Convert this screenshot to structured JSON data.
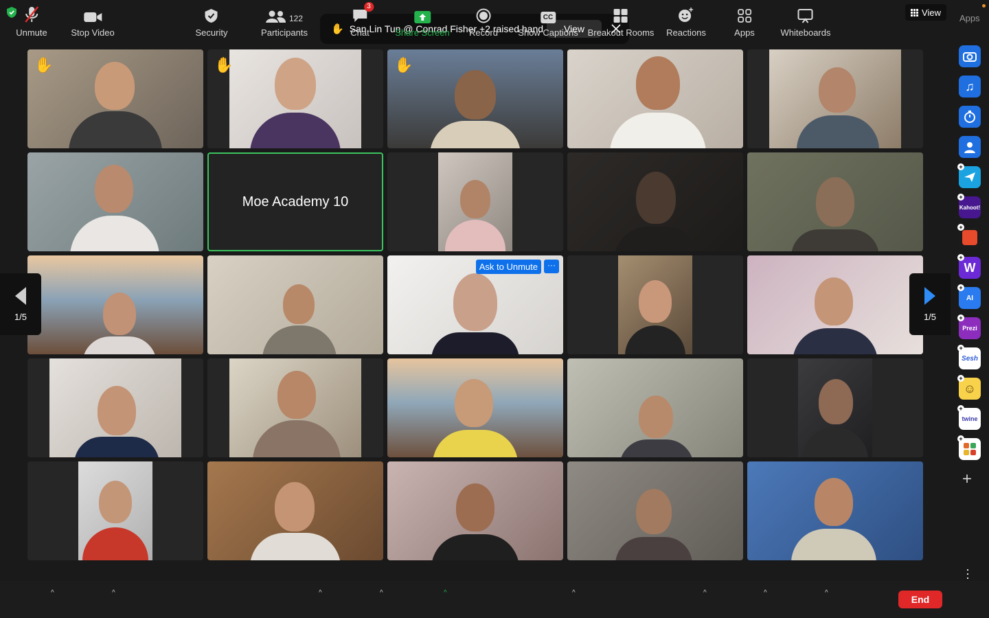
{
  "banner": {
    "hand": "✋",
    "text": "San Lin Tun @ Conrad Fisher +2 raised hand",
    "view_label": "View"
  },
  "top_right": {
    "view_label": "View",
    "apps_label": "Apps"
  },
  "named_tile": {
    "name": "Moe Academy 10"
  },
  "ask_to_unmute": {
    "label": "Ask to Unmute",
    "more": "···"
  },
  "raised_hand_glyph": "✋",
  "pager": {
    "left_label": "1/5",
    "right_label": "1/5"
  },
  "apps_sidebar": [
    {
      "name": "camera-app-icon",
      "label": "",
      "color": "#1f6fe0"
    },
    {
      "name": "music-app-icon",
      "label": "",
      "color": "#1f6fe0"
    },
    {
      "name": "timer-app-icon",
      "label": "",
      "color": "#1f6fe0"
    },
    {
      "name": "avatar-app-icon",
      "label": "",
      "color": "#1f6fe0"
    },
    {
      "name": "send-app-icon",
      "label": "",
      "color": "#1aa3e0"
    },
    {
      "name": "kahoot-app-icon",
      "label": "Kahoot!",
      "color": "#46178f"
    },
    {
      "name": "red-app-icon",
      "label": "",
      "color": "#e84a2c"
    },
    {
      "name": "w-app-icon",
      "label": "W",
      "color": "#6b2ad6"
    },
    {
      "name": "ai-app-icon",
      "label": "AI",
      "color": "#2a7bf0"
    },
    {
      "name": "prezi-app-icon",
      "label": "Prezi",
      "color": "#8c2dbe"
    },
    {
      "name": "sesh-app-icon",
      "label": "Sesh",
      "color": "#ffffff"
    },
    {
      "name": "emoji-app-icon",
      "label": "",
      "color": "#f8d24a"
    },
    {
      "name": "twine-app-icon",
      "label": "twine",
      "color": "#ffffff"
    },
    {
      "name": "grid-app-icon",
      "label": "",
      "color": "#ffffff"
    }
  ],
  "toolbar": {
    "unmute": "Unmute",
    "stop_video": "Stop Video",
    "security": "Security",
    "participants": "Participants",
    "participants_count": "122",
    "chat": "Chat",
    "chat_badge": "3",
    "share_screen": "Share Screen",
    "record": "Record",
    "captions_badge": "CC",
    "show_captions": "Show Captions",
    "breakout_rooms": "Breakout Rooms",
    "reactions": "Reactions",
    "apps": "Apps",
    "whiteboards": "Whiteboards",
    "end": "End"
  },
  "colors": {
    "accent": "#0e71eb",
    "share": "#24b24c",
    "end": "#e02828",
    "active_border": "#3ac45e"
  }
}
